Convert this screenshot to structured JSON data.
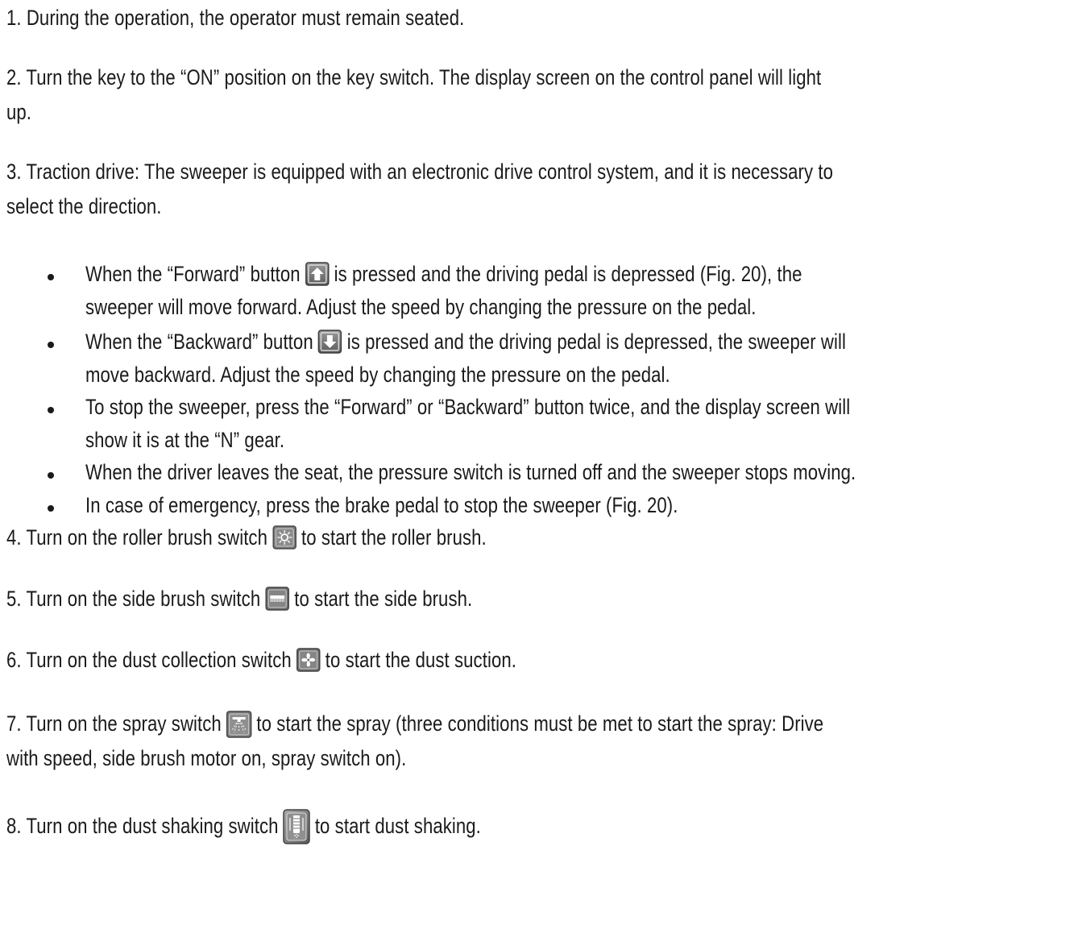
{
  "steps": {
    "s1": "1. During the operation, the operator must remain seated.",
    "s2a": "2. Turn the key to the “ON” position on the key switch. The display screen on the control panel will light",
    "s2b": "up.",
    "s3a": "3. Traction drive: The sweeper is equipped with an electronic drive control system, and it is necessary to",
    "s3b": "select the direction.",
    "s4a": "4. Turn on the roller brush switch",
    "s4b": "to start the roller brush.",
    "s5a": "5. Turn on the side brush switch",
    "s5b": "to start the side brush.",
    "s6a": "6. Turn on the dust collection switch",
    "s6b": " to start the dust suction.",
    "s7a": "7. Turn on the spray switch",
    "s7b": "to start the spray (three conditions must be met to start the spray: Drive",
    "s7c": "with speed, side brush motor on, spray switch on).",
    "s8a": "8. Turn on the dust shaking switch",
    "s8b": "to start dust shaking."
  },
  "bullets": {
    "b1a": "When the “Forward” button",
    "b1b": "is pressed and the driving pedal is depressed (Fig. 20), the",
    "b1c": "sweeper will move forward. Adjust the speed by changing the pressure on the pedal.",
    "b2a": "When the “Backward” button",
    "b2b": "is pressed and the driving pedal is depressed, the sweeper will",
    "b2c": "move backward. Adjust the speed by changing the pressure on the pedal.",
    "b3a": "To stop the sweeper, press the “Forward” or “Backward” button twice, and the display screen will",
    "b3b": "show it is at the “N” gear.",
    "b4": "When the driver leaves the seat, the pressure switch is turned off and the sweeper stops moving.",
    "b5": "In case of emergency, press the brake pedal to stop the sweeper (Fig. 20)."
  },
  "icons": {
    "forward": "forward-arrow-button-icon",
    "backward": "backward-arrow-button-icon",
    "roller_brush": "roller-brush-switch-icon",
    "side_brush": "side-brush-switch-icon",
    "dust_collection": "dust-collection-fan-icon",
    "spray": "spray-switch-icon",
    "dust_shaking": "dust-shaking-switch-icon"
  },
  "colors": {
    "text": "#1a1a1a",
    "icon_bg": "#7a7a7a",
    "icon_border": "#4a4a4a",
    "icon_fg": "#ffffff"
  }
}
